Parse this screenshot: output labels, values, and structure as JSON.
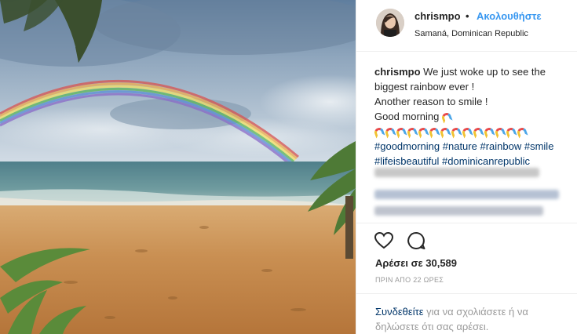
{
  "post": {
    "image_alt": "Rainbow over a tropical beach",
    "colors": {
      "accent": "#3897f0",
      "link": "#003569",
      "muted": "#999999",
      "text": "#262626"
    }
  },
  "header": {
    "username": "chrismpo",
    "dot": "•",
    "follow_label": "Ακολουθήστε",
    "location": "Samaná, Dominican Republic"
  },
  "caption": {
    "username": "chrismpo",
    "line1": "We just woke up to see the",
    "line2": "biggest rainbow ever !",
    "line3": "Another reason to smile !",
    "line4": "Good morning",
    "rainbow_count": 14,
    "hashtags_line1": [
      "#goodmorning",
      "#nature",
      "#rainbow",
      "#smile"
    ],
    "hashtags_line2": [
      "#lifeisbeautiful",
      "#dominicanrepublic"
    ]
  },
  "actions": {
    "like_icon": "heart-icon",
    "comment_icon": "comment-icon",
    "likes_text": "Αρέσει σε 30,589",
    "timestamp": "ΠΡΙΝ ΑΠΟ 22 ΩΡΕΣ"
  },
  "comment_prompt": {
    "login_link": "Συνδεθείτε",
    "rest": " για να σχολιάσετε ή να δηλώσετε ότι σας αρέσει."
  }
}
